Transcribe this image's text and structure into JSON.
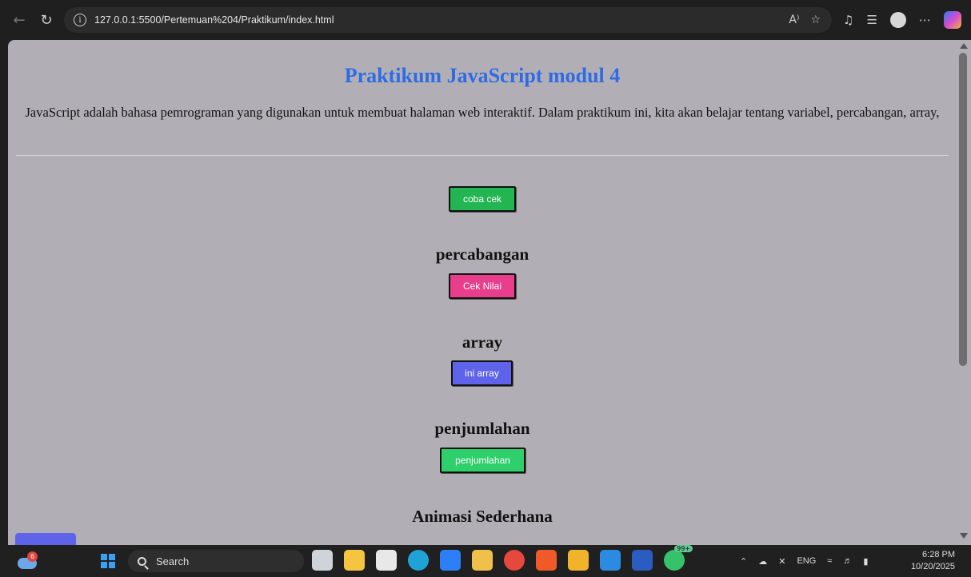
{
  "browser": {
    "url": "127.0.0.1:5500/Pertemuan%204/Praktikum/index.html",
    "read_aloud_label": "A⁾"
  },
  "page": {
    "title": "Praktikum JavaScript modul 4",
    "intro": "JavaScript adalah bahasa pemrograman yang digunakan untuk membuat halaman web interaktif. Dalam praktikum ini, kita akan belajar tentang variabel, percabangan, array,",
    "buttons": {
      "coba_cek": "coba cek",
      "cek_nilai": "Cek Nilai",
      "ini_array": "ini array",
      "penjumlahan": "penjumlahan"
    },
    "headings": {
      "percabangan": "percabangan",
      "array": "array",
      "penjumlahan": "penjumlahan",
      "animasi": "Animasi Sederhana"
    },
    "colors": {
      "title": "#2f6be5",
      "coba_cek": "#22b552",
      "cek_nilai": "#e83e8c",
      "ini_array": "#5f63ea",
      "penjumlahan": "#2fcf6b",
      "background": "#b1afb5"
    }
  },
  "taskbar": {
    "weather_badge": "6",
    "search_label": "Search",
    "whatsapp_badge": "99+",
    "language": "ENG",
    "time": "6:28 PM",
    "date": "10/20/2025",
    "apps": [
      "task-view-icon",
      "file-explorer-icon",
      "store-icon",
      "edge-icon",
      "todo-icon",
      "app-icon",
      "chrome-icon",
      "brave-icon",
      "app-grid-icon",
      "vscode-icon",
      "word-icon",
      "whatsapp-icon"
    ]
  }
}
